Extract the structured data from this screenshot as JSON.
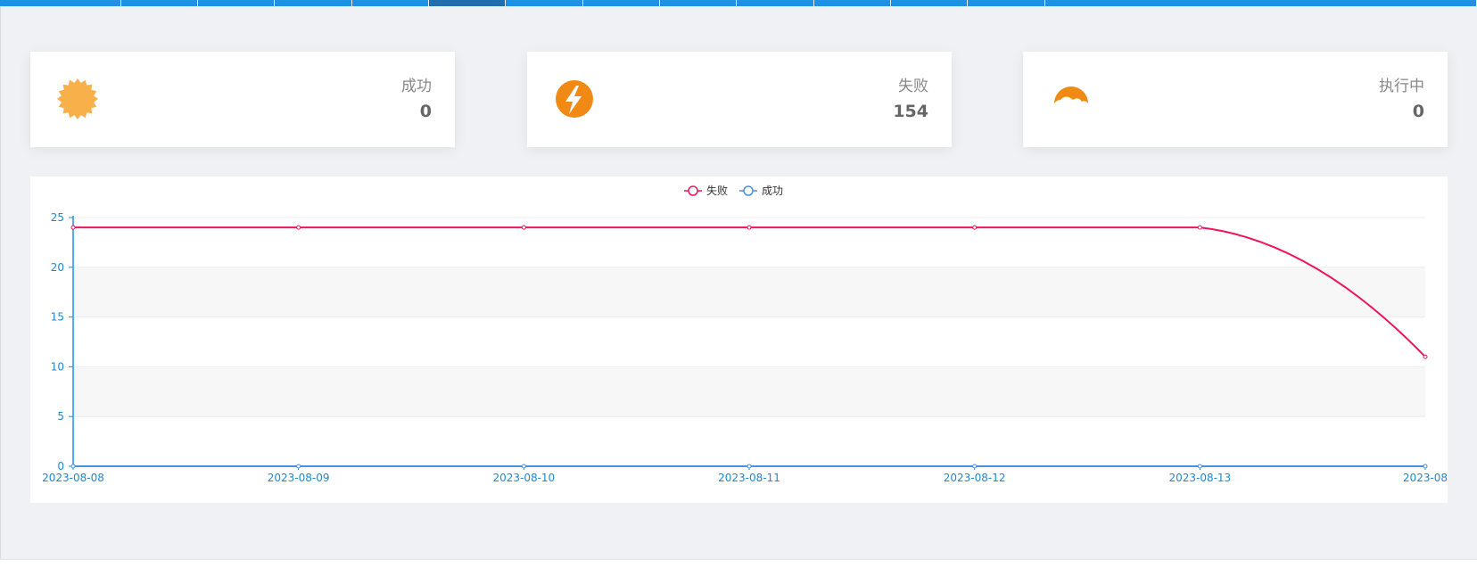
{
  "nav_tabs_count": 14,
  "cards": {
    "success": {
      "label": "成功",
      "value": "0",
      "icon": "sun-icon",
      "color": "#f8b04a"
    },
    "fail": {
      "label": "失败",
      "value": "154",
      "icon": "lightning-icon",
      "color": "#f08a14"
    },
    "running": {
      "label": "执行中",
      "value": "0",
      "icon": "moon-icon",
      "color": "#f08a14"
    }
  },
  "colors": {
    "nav": "#1e90e8",
    "fail_series": "#f0145a",
    "success_series": "#4a90e2",
    "axis": "#1e90e8"
  },
  "chart_data": {
    "type": "line",
    "legend": [
      "失败",
      "成功"
    ],
    "legend_position": "top-center",
    "x": [
      "2023-08-08",
      "2023-08-09",
      "2023-08-10",
      "2023-08-11",
      "2023-08-12",
      "2023-08-13",
      "2023-08"
    ],
    "series": [
      {
        "name": "失败",
        "values": [
          24,
          24,
          24,
          24,
          24,
          24,
          11
        ],
        "color": "#f0145a"
      },
      {
        "name": "成功",
        "values": [
          0,
          0,
          0,
          0,
          0,
          0,
          0
        ],
        "color": "#4a90e2"
      }
    ],
    "yticks": [
      0,
      5,
      10,
      15,
      20,
      25
    ],
    "ylim": [
      0,
      25
    ],
    "grid": true
  }
}
